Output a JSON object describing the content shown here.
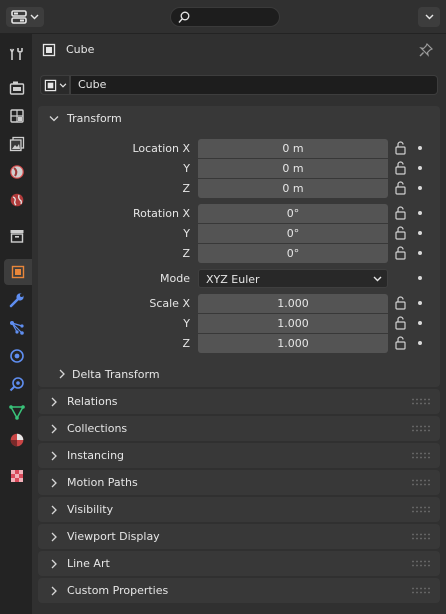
{
  "header": {
    "editor_icon": "properties-editor-icon",
    "search_placeholder": "",
    "options_icon": "chevron-down-icon"
  },
  "tabs": [
    {
      "name": "tool",
      "icon": "tool-icon"
    },
    {
      "name": "render",
      "icon": "render-icon"
    },
    {
      "name": "output",
      "icon": "output-icon"
    },
    {
      "name": "view-layer",
      "icon": "view-layer-icon"
    },
    {
      "name": "scene",
      "icon": "scene-icon"
    },
    {
      "name": "world",
      "icon": "world-icon"
    },
    {
      "name": "collection",
      "icon": "collection-icon"
    },
    {
      "name": "object",
      "icon": "object-icon",
      "active": true
    },
    {
      "name": "modifiers",
      "icon": "wrench-icon"
    },
    {
      "name": "particles",
      "icon": "particles-icon"
    },
    {
      "name": "physics",
      "icon": "physics-icon"
    },
    {
      "name": "constraints",
      "icon": "constraints-icon"
    },
    {
      "name": "data",
      "icon": "mesh-data-icon"
    },
    {
      "name": "material",
      "icon": "material-icon"
    },
    {
      "name": "texture",
      "icon": "texture-icon"
    }
  ],
  "context": {
    "object_name": "Cube"
  },
  "name_field": {
    "value": "Cube"
  },
  "transform": {
    "title": "Transform",
    "location": {
      "label": "Location X",
      "y_label": "Y",
      "z_label": "Z",
      "x": "0 m",
      "y": "0 m",
      "z": "0 m"
    },
    "rotation": {
      "label": "Rotation X",
      "y_label": "Y",
      "z_label": "Z",
      "x": "0°",
      "y": "0°",
      "z": "0°"
    },
    "mode": {
      "label": "Mode",
      "value": "XYZ Euler"
    },
    "scale": {
      "label": "Scale X",
      "y_label": "Y",
      "z_label": "Z",
      "x": "1.000",
      "y": "1.000",
      "z": "1.000"
    },
    "delta_title": "Delta Transform"
  },
  "sections": [
    "Relations",
    "Collections",
    "Instancing",
    "Motion Paths",
    "Visibility",
    "Viewport Display",
    "Line Art",
    "Custom Properties"
  ],
  "colors": {
    "accent_object": "#e9863a",
    "field": "#545454",
    "panel": "#383838"
  }
}
